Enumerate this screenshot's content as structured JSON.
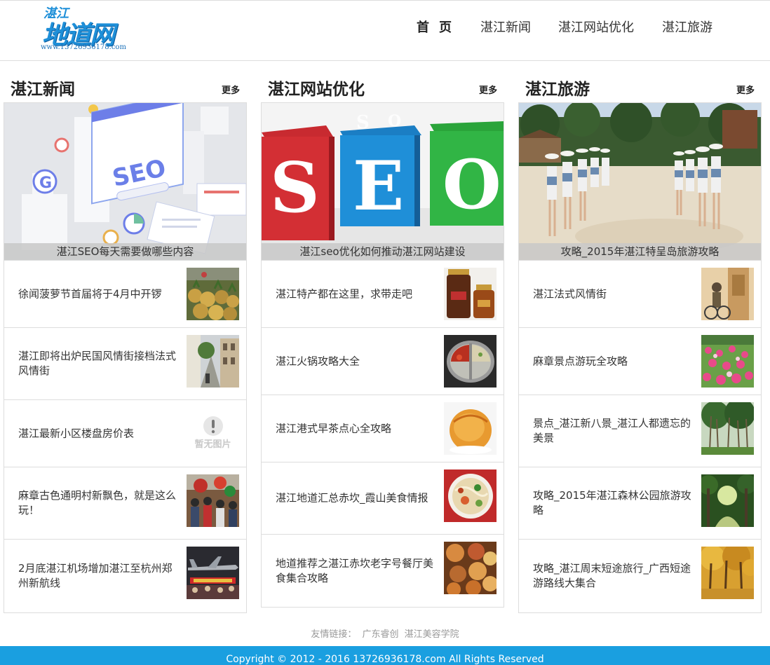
{
  "logo": {
    "line1": "湛江",
    "line2": "地道网",
    "line3": "www.13726936178.com"
  },
  "nav": {
    "home": "首页",
    "news": "湛江新闻",
    "seo": "湛江网站优化",
    "travel": "湛江旅游"
  },
  "more_label": "更多",
  "columns": [
    {
      "title": "湛江新闻",
      "feature_caption": "湛江SEO每天需要做哪些内容",
      "items": [
        {
          "text": "徐闻菠萝节首届将于4月中开锣",
          "thumb": "pineapple-icon"
        },
        {
          "text": "湛江即将出炉民国风情街接档法式风情街",
          "thumb": "street-icon"
        },
        {
          "text": "湛江最新小区楼盘房价表",
          "thumb": "no-image-icon",
          "no_image": "暂无图片"
        },
        {
          "text": "麻章古色通明村新飘色，就是这么玩！",
          "thumb": "parade-icon"
        },
        {
          "text": "2月底湛江机场增加湛江至杭州郑州新航线",
          "thumb": "airplane-icon"
        }
      ]
    },
    {
      "title": "湛江网站优化",
      "feature_caption": "湛江seo优化如何推动湛江网站建设",
      "items": [
        {
          "text": "湛江特产都在这里，求带走吧",
          "thumb": "jars-icon"
        },
        {
          "text": "湛江火锅攻略大全",
          "thumb": "hotpot-icon"
        },
        {
          "text": "湛江港式早茶点心全攻略",
          "thumb": "pastry-icon"
        },
        {
          "text": "湛江地道汇总赤坎_霞山美食情报",
          "thumb": "noodles-icon"
        },
        {
          "text": "地道推荐之湛江赤坎老字号餐厅美食集合攻略",
          "thumb": "dishes-icon"
        }
      ]
    },
    {
      "title": "湛江旅游",
      "feature_caption": "攻略_2015年湛江特呈岛旅游攻略",
      "items": [
        {
          "text": "湛江法式风情街",
          "thumb": "statue-icon"
        },
        {
          "text": "麻章景点游玩全攻略",
          "thumb": "flowers-icon"
        },
        {
          "text": "景点_湛江新八景_湛江人都遗忘的美景",
          "thumb": "banyan-icon"
        },
        {
          "text": "攻略_2015年湛江森林公园旅游攻略",
          "thumb": "forest-icon"
        },
        {
          "text": "攻略_湛江周末短途旅行_广西短途游路线大集合",
          "thumb": "autumn-trees-icon"
        }
      ]
    }
  ],
  "footer": {
    "links_label": "友情链接：",
    "links": [
      "广东睿创",
      "湛江美容学院"
    ],
    "copyright": "Copyright © 2012 - 2016 13726936178.com All Rights Reserved"
  },
  "colors": {
    "brand_blue": "#1e8fd8",
    "footer_bar": "#1a9fe0",
    "border": "#dddddd"
  }
}
